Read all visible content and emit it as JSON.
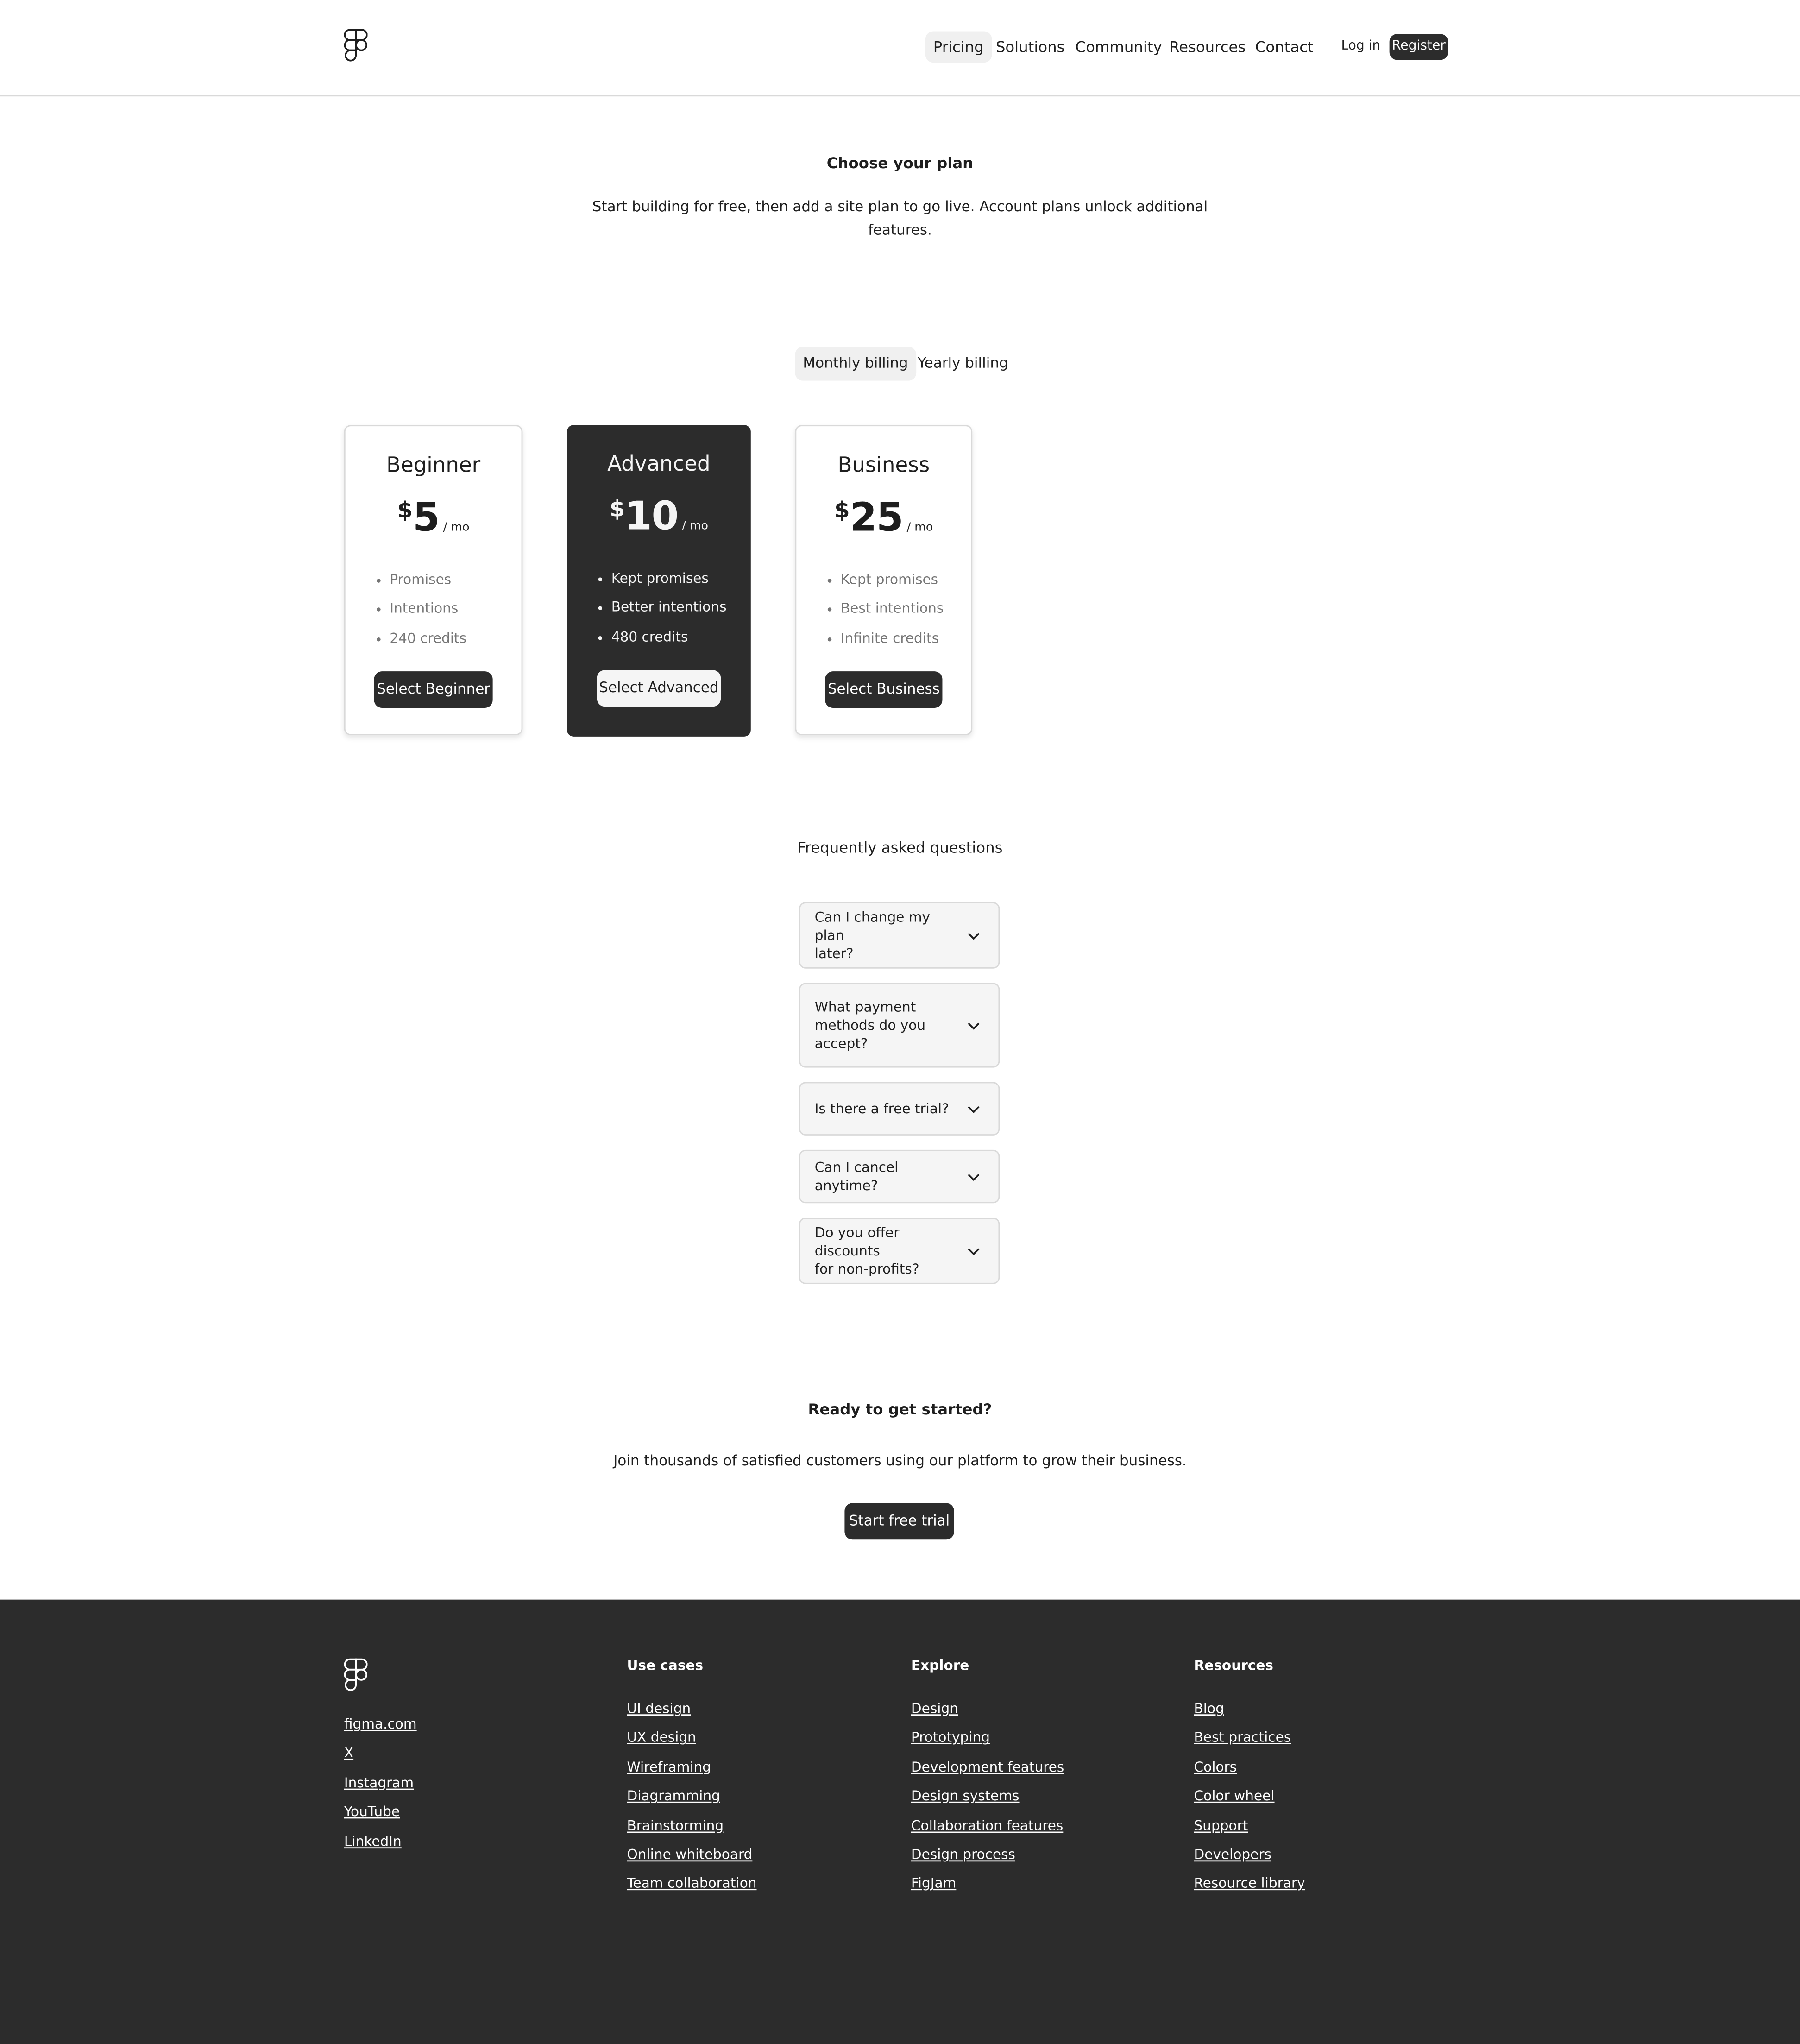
{
  "header": {
    "logo_icon": "figma-logo-icon",
    "nav": [
      "Pricing",
      "Solutions",
      "Community",
      "Resources",
      "Contact"
    ],
    "active_nav": "Pricing",
    "login_label": "Log in",
    "register_label": "Register"
  },
  "hero": {
    "title": "Choose your plan",
    "subtitle_line1": "Start building for free, then add a site plan to go live. Account plans unlock additional",
    "subtitle_line2": "features."
  },
  "billing": {
    "options": [
      "Monthly billing",
      "Yearly billing"
    ],
    "selected": "Monthly billing"
  },
  "plans": [
    {
      "name": "Beginner",
      "currency": "$",
      "price": "5",
      "period": "/ mo",
      "features": [
        "Promises",
        "Intentions",
        "240 credits"
      ],
      "button": "Select Beginner",
      "theme": "light"
    },
    {
      "name": "Advanced",
      "currency": "$",
      "price": "10",
      "period": "/ mo",
      "features": [
        "Kept promises",
        "Better intentions",
        "480 credits"
      ],
      "button": "Select Advanced",
      "theme": "dark"
    },
    {
      "name": "Business",
      "currency": "$",
      "price": "25",
      "period": "/ mo",
      "features": [
        "Kept promises",
        "Best intentions",
        "Infinite credits"
      ],
      "button": "Select Business",
      "theme": "light"
    }
  ],
  "faq": {
    "title": "Frequently asked questions",
    "expand_icon": "chevron-down-icon",
    "items": [
      {
        "question_lines": [
          "Can I change my plan",
          "later?"
        ]
      },
      {
        "question_lines": [
          "What payment",
          "methods do you",
          "accept?"
        ]
      },
      {
        "question_lines": [
          "Is there a free trial?"
        ]
      },
      {
        "question_lines": [
          "Can I cancel anytime?"
        ]
      },
      {
        "question_lines": [
          "Do you offer discounts",
          "for non-profits?"
        ]
      }
    ]
  },
  "cta": {
    "title": "Ready to get started?",
    "subtitle": "Join thousands of satisfied customers using our platform to grow their business.",
    "button": "Start free trial"
  },
  "footer": {
    "logo_icon": "figma-logo-icon",
    "social": [
      "figma.com",
      "X",
      "Instagram",
      "YouTube",
      "LinkedIn"
    ],
    "columns": [
      {
        "heading": "Use cases",
        "links": [
          "UI design",
          "UX design",
          "Wireframing",
          "Diagramming",
          "Brainstorming",
          "Online whiteboard",
          "Team collaboration"
        ]
      },
      {
        "heading": "Explore",
        "links": [
          "Design",
          "Prototyping",
          "Development features",
          "Design systems",
          "Collaboration features",
          "Design process",
          "FigJam"
        ]
      },
      {
        "heading": "Resources",
        "links": [
          "Blog",
          "Best practices",
          "Colors",
          "Color wheel",
          "Support",
          "Developers",
          "Resource library"
        ]
      }
    ]
  },
  "colors": {
    "dark": "#2c2c2c",
    "light_bg": "#f5f5f5",
    "border": "#d9d9d9",
    "muted_text": "#757575"
  }
}
